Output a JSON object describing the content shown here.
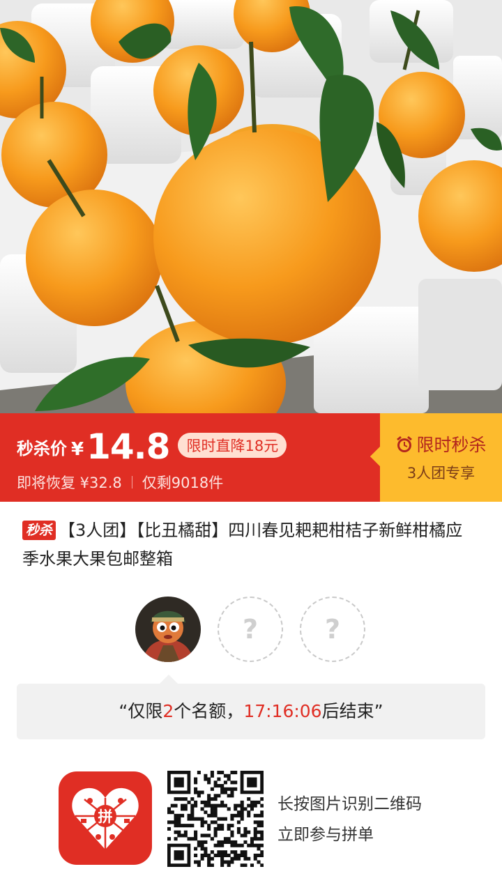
{
  "hero": {
    "image_icon": "oranges-in-foam-tray-photo"
  },
  "banner": {
    "price_label": "秒杀价",
    "currency": "¥",
    "price": "14.8",
    "drop_badge": "限时直降18元",
    "restore_text": "即将恢复 ¥32.8",
    "stock_text": "仅剩9018件",
    "flash_title": "限时秒杀",
    "flash_sub": "3人团专享",
    "colors": {
      "primary": "#e02e24",
      "accent": "#fdbb2d"
    }
  },
  "product": {
    "tag": "秒杀",
    "title": "【3人团】【比丑橘甜】四川春见耙耙柑桔子新鲜柑橘应季水果大果包邮整箱"
  },
  "group": {
    "slots": [
      {
        "type": "avatar",
        "icon": "user-avatar"
      },
      {
        "type": "empty",
        "label": "?"
      },
      {
        "type": "empty",
        "label": "?"
      }
    ]
  },
  "notice": {
    "open_quote": "“",
    "prefix": "仅限",
    "count": "2",
    "mid": "个名额，",
    "countdown": "17:16:06",
    "suffix": "后结束",
    "close_quote": "”"
  },
  "footer": {
    "logo_icon": "pinduoduo-logo-icon",
    "logo_text": "拼",
    "qr_icon": "qr-code-icon",
    "line1": "长按图片识别二维码",
    "line2": "立即参与拼单"
  }
}
